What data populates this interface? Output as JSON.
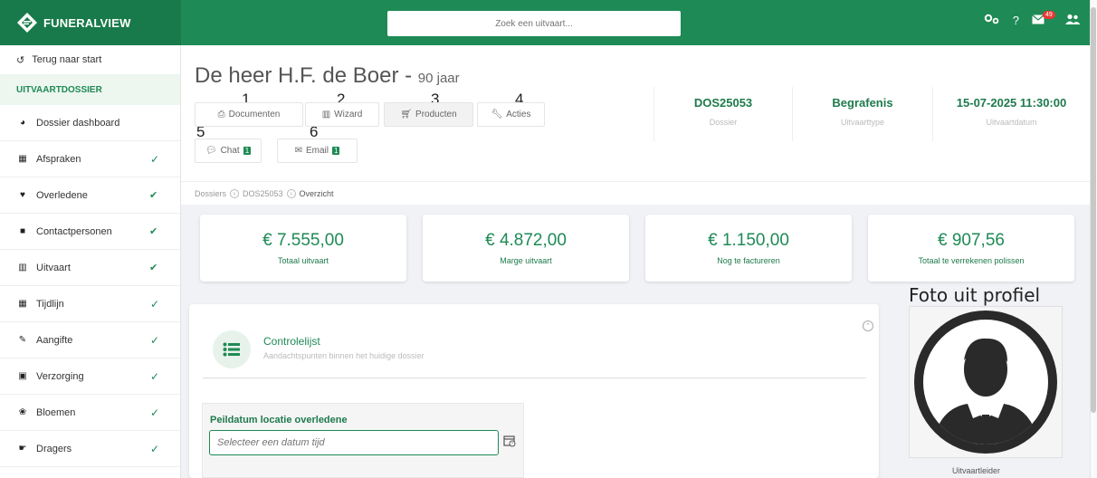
{
  "app": {
    "brand": "FUNERALVIEW"
  },
  "search": {
    "placeholder": "Zoek een uitvaart..."
  },
  "topbar": {
    "mail_count": "49"
  },
  "sidebar": {
    "back_label": "Terug naar start",
    "section_label": "UITVAARTDOSSIER",
    "items": [
      {
        "label": "Dossier dashboard",
        "icon": "dashboard-icon",
        "check": ""
      },
      {
        "label": "Afspraken",
        "icon": "calendar-icon",
        "check": "single"
      },
      {
        "label": "Overledene",
        "icon": "heart-icon",
        "check": "double"
      },
      {
        "label": "Contactpersonen",
        "icon": "contact-icon",
        "check": "double"
      },
      {
        "label": "Uitvaart",
        "icon": "building-icon",
        "check": "double"
      },
      {
        "label": "Tijdlijn",
        "icon": "calendar-icon",
        "check": "single"
      },
      {
        "label": "Aangifte",
        "icon": "pen-icon",
        "check": "single"
      },
      {
        "label": "Verzorging",
        "icon": "briefcase-icon",
        "check": "single"
      },
      {
        "label": "Bloemen",
        "icon": "flower-icon",
        "check": "single"
      },
      {
        "label": "Dragers",
        "icon": "hand-icon",
        "check": "single"
      }
    ]
  },
  "header": {
    "person_name": "De heer H.F. de Boer -",
    "age": "90 jaar",
    "tabs": [
      {
        "num": "1",
        "label": "Documenten",
        "icon": "print-icon"
      },
      {
        "num": "2",
        "label": "Wizard",
        "icon": "columns-icon"
      },
      {
        "num": "3",
        "label": "Producten",
        "icon": "cart-icon"
      },
      {
        "num": "4",
        "label": "Acties",
        "icon": "wrench-icon"
      },
      {
        "num": "5",
        "label": "Chat",
        "icon": "chat-icon",
        "count": "1"
      },
      {
        "num": "6",
        "label": "Email",
        "icon": "mail-icon",
        "count": "1"
      }
    ],
    "meta": [
      {
        "value": "DOS25053",
        "label": "Dossier"
      },
      {
        "value": "Begrafenis",
        "label": "Uitvaarttype"
      },
      {
        "value": "15-07-2025 11:30:00",
        "label": "Uitvaartdatum"
      }
    ]
  },
  "breadcrumb": {
    "items": [
      "Dossiers",
      "DOS25053",
      "Overzicht"
    ]
  },
  "stats": [
    {
      "value": "€ 7.555,00",
      "label": "Totaal uitvaart"
    },
    {
      "value": "€ 4.872,00",
      "label": "Marge uitvaart"
    },
    {
      "value": "€ 1.150,00",
      "label": "Nog te factureren"
    },
    {
      "value": "€ 907,56",
      "label": "Totaal te verrekenen polissen"
    }
  ],
  "controlelijst": {
    "title": "Controlelijst",
    "subtitle": "Aandachtspunten binnen het huidige dossier",
    "peildatum_label": "Peildatum locatie overledene",
    "peildatum_placeholder": "Selecteer een datum tijd"
  },
  "profile": {
    "title": "Foto uit profiel",
    "role": "Uitvaartleider"
  },
  "colors": {
    "brand_green": "#1e8a55",
    "badge_red": "#e53935"
  }
}
